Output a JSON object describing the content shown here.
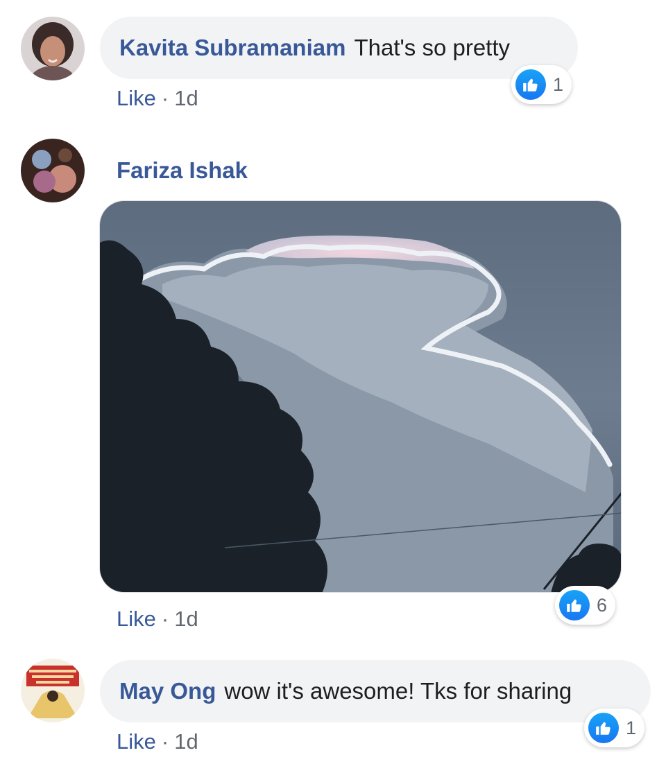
{
  "comments": [
    {
      "author": "Kavita Subramaniam",
      "text": "That's so pretty",
      "like_label": "Like",
      "separator": "·",
      "time": "1d",
      "reaction_icon": "thumbs-up-icon",
      "reaction_count": "1"
    },
    {
      "author": "Fariza Ishak",
      "text": "",
      "attachment_icon": "photo-clouds-and-tree",
      "like_label": "Like",
      "separator": "·",
      "time": "1d",
      "reaction_icon": "thumbs-up-icon",
      "reaction_count": "6"
    },
    {
      "author": "May Ong",
      "text": "wow it's awesome! Tks for sharing",
      "like_label": "Like",
      "separator": "·",
      "time": "1d",
      "reaction_icon": "thumbs-up-icon",
      "reaction_count": "1"
    }
  ],
  "colors": {
    "author": "#385898",
    "bubble": "#f2f3f5",
    "meta": "#606770",
    "like_badge": "#1877f2"
  }
}
